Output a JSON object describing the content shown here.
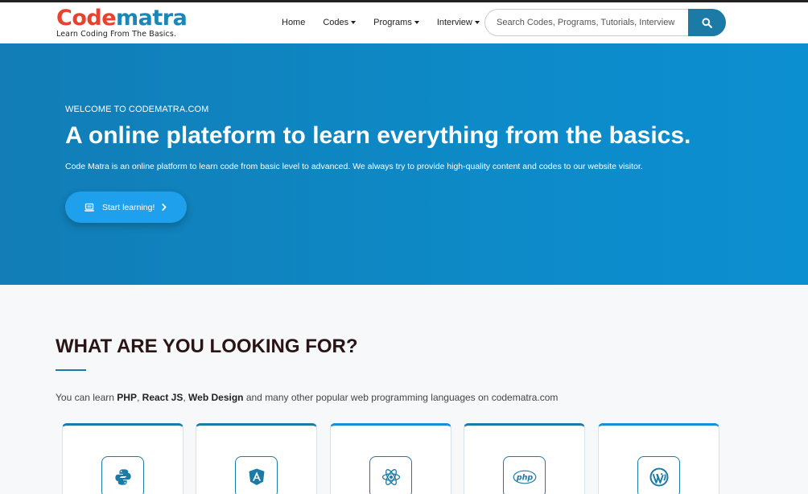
{
  "brand": {
    "name_part1": "Code",
    "name_part2": "matra",
    "tagline": "Learn Coding From The Basics."
  },
  "nav": {
    "items": [
      {
        "label": "Home",
        "dropdown": false
      },
      {
        "label": "Codes",
        "dropdown": true
      },
      {
        "label": "Programs",
        "dropdown": true
      },
      {
        "label": "Interview",
        "dropdown": true
      }
    ]
  },
  "search": {
    "placeholder": "Search Codes, Programs, Tutorials, Interview Qu",
    "value": "",
    "icon": "search-icon"
  },
  "hero": {
    "welcome": "WELCOME TO CODEMATRA.COM",
    "title": "A online plateform to learn everything from the basics.",
    "description": "Code Matra is an online platform to learn code from basic level to advanced. We always try to provide high-quality content and codes to our website visitor.",
    "cta_label": "Start learning!",
    "cta_icon": "laptop-icon"
  },
  "section": {
    "title": "WHAT ARE YOU LOOKING FOR?",
    "desc_prefix": "You can learn ",
    "highlight_1": "PHP",
    "sep_1": ", ",
    "highlight_2": "React JS",
    "sep_2": ", ",
    "highlight_3": "Web Design",
    "desc_suffix": " and many other popular web programming languages on codematra.com"
  },
  "cards": [
    {
      "icon": "python-icon"
    },
    {
      "icon": "angular-icon"
    },
    {
      "icon": "react-icon"
    },
    {
      "icon": "php-icon",
      "icon_text": "php"
    },
    {
      "icon": "wordpress-icon"
    }
  ],
  "colors": {
    "brand_red": "#e8412c",
    "brand_blue": "#1c87b6",
    "accent": "#1c7aa6",
    "hero_bg": "#0d89c6",
    "cta_bg": "#1ea0ec"
  }
}
